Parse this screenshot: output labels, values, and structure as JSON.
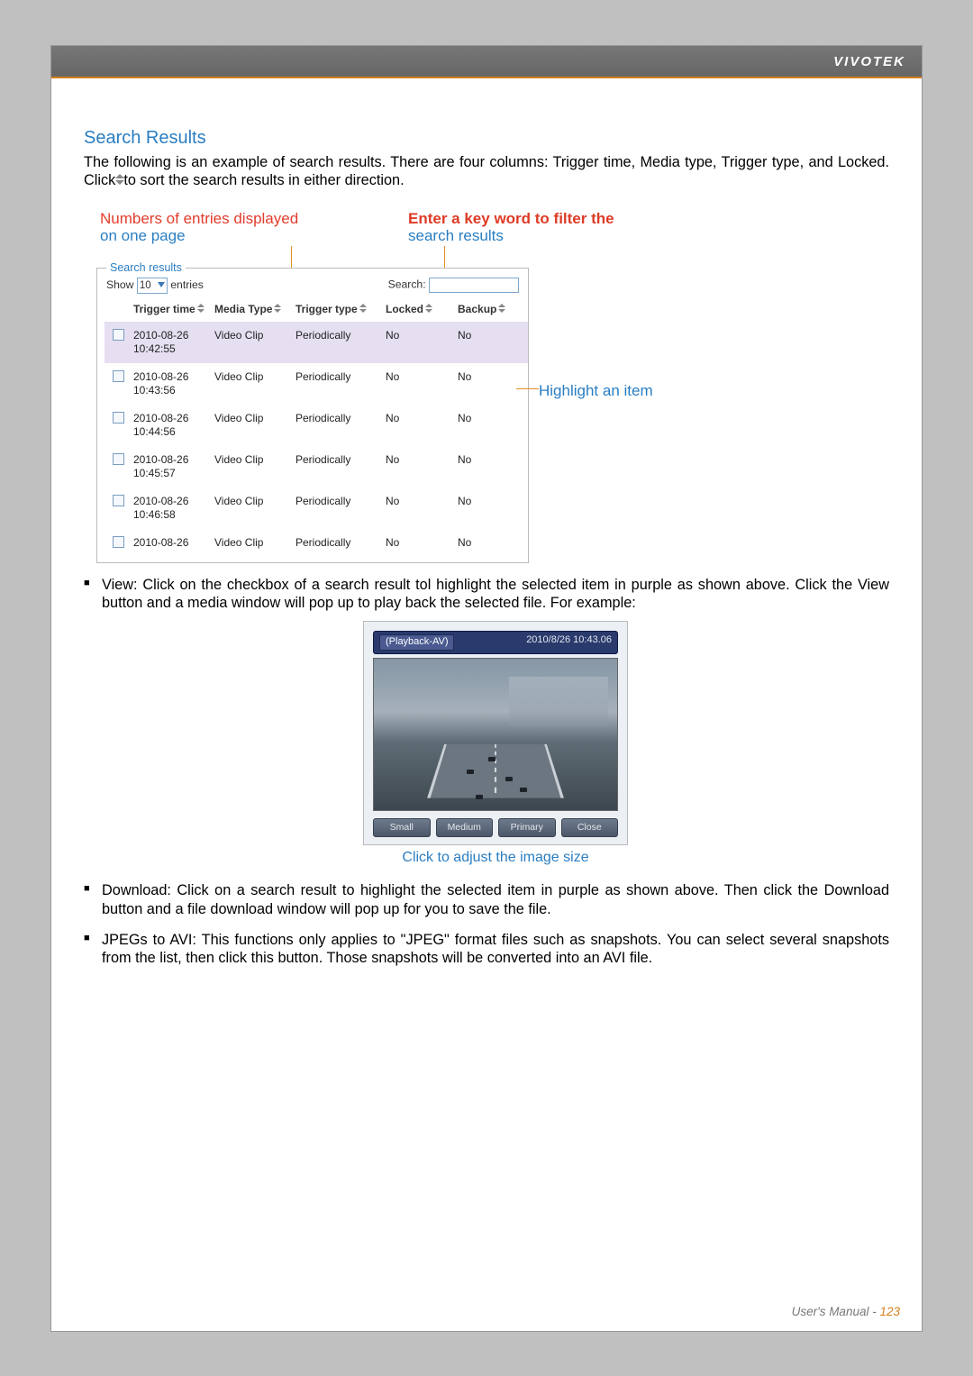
{
  "brand": "VIVOTEK",
  "section_title": "Search Results",
  "intro_a": "The following is an example of search results. There are four columns: Trigger time, Media type, Trigger type, and Locked. Click ",
  "intro_b": " to sort the search results in either direction.",
  "label1_r": "Numbers of entries displayed",
  "label1_b": "on one page",
  "label2_r": "Enter a key word to filter the",
  "label2_b": "search results",
  "highlight_label": "Highlight an item",
  "panel": {
    "legend": "Search results",
    "show": "Show",
    "entries_value": "10",
    "entries_word": "entries",
    "search_label": "Search:",
    "columns": {
      "trigger_time": "Trigger time",
      "media_type": "Media Type",
      "trigger_type": "Trigger type",
      "locked": "Locked",
      "backup": "Backup"
    },
    "rows": [
      {
        "time1": "2010-08-26",
        "time2": "10:42:55",
        "media": "Video Clip",
        "trigger": "Periodically",
        "locked": "No",
        "backup": "No"
      },
      {
        "time1": "2010-08-26",
        "time2": "10:43:56",
        "media": "Video Clip",
        "trigger": "Periodically",
        "locked": "No",
        "backup": "No"
      },
      {
        "time1": "2010-08-26",
        "time2": "10:44:56",
        "media": "Video Clip",
        "trigger": "Periodically",
        "locked": "No",
        "backup": "No"
      },
      {
        "time1": "2010-08-26",
        "time2": "10:45:57",
        "media": "Video Clip",
        "trigger": "Periodically",
        "locked": "No",
        "backup": "No"
      },
      {
        "time1": "2010-08-26",
        "time2": "10:46:58",
        "media": "Video Clip",
        "trigger": "Periodically",
        "locked": "No",
        "backup": "No"
      },
      {
        "time1": "2010-08-26",
        "time2": "",
        "media": "Video Clip",
        "trigger": "Periodically",
        "locked": "No",
        "backup": "No"
      }
    ]
  },
  "playback": {
    "title": "(Playback-AV)",
    "timestamp": "2010/8/26 10:43.06",
    "buttons": {
      "small": "Small",
      "medium": "Medium",
      "primary": "Primary",
      "close": "Close"
    },
    "caption": "Click to adjust the image size"
  },
  "bullets": {
    "view": "View: Click on the checkbox of a search result tol highlight the selected item in purple as shown above. Click the View button and a media window will pop up to play back the selected file. For example:",
    "download": "Download: Click on a search result to highlight the selected item in purple as shown above. Then click the Download button and a file download window will pop up for you to save the file.",
    "jpegs": "JPEGs to AVI: This functions only applies to \"JPEG\" format files such as snapshots. You can select several snapshots from the list, then click this button. Those snapshots will be converted into an AVI file."
  },
  "footer": {
    "label": "User's Manual - ",
    "page": "123"
  }
}
